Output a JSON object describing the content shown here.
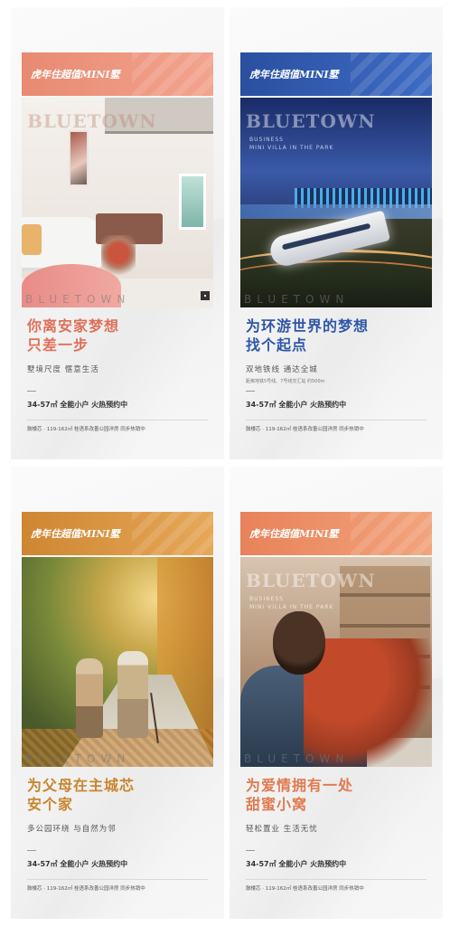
{
  "posters": [
    {
      "banner": "虎年住超值MINI墅",
      "banner_color": "#e8866e",
      "headline_lines": [
        "你离安家梦想",
        "只差一步"
      ],
      "headline_color": "#e0705a",
      "subline": "墅境尺度  惬意生活",
      "detail": "",
      "promo": "34-57㎡ 全能小户  火热预约中",
      "footer": "鼓楼芯 · 119-162㎡ 桂语系改善公园洋房  同步热销中",
      "watermark_big": "BLUETOWN",
      "watermark_bottom": "BLUETOWN"
    },
    {
      "banner": "虎年住超值MINI墅",
      "banner_color": "#2f56a8",
      "headline_lines": [
        "为环游世界的梦想",
        "找个起点"
      ],
      "headline_color": "#2f56a8",
      "subline": "双地铁线  通达全城",
      "detail": "距离地铁5号线、7号线交汇站 约500m",
      "promo": "34-57㎡ 全能小户  火热预约中",
      "footer": "鼓楼芯 · 119-162㎡ 桂语系改善公园洋房  同步热销中",
      "watermark_big": "BLUETOWN",
      "watermark_sub": [
        "BUSINESS",
        "MINI VILLA IN THE PARK"
      ],
      "watermark_bottom": "BLUETOWN"
    },
    {
      "banner": "虎年住超值MINI墅",
      "banner_color": "#d08a3a",
      "headline_lines": [
        "为父母在主城芯",
        "安个家"
      ],
      "headline_color": "#c9852e",
      "subline": "多公园环绕  与自然为邻",
      "detail": "",
      "promo": "34-57㎡ 全能小户  火热预约中",
      "footer": "鼓楼芯 · 119-162㎡ 桂语系改善公园洋房  同步热销中",
      "watermark_big": "",
      "watermark_bottom": "BLUETOWN"
    },
    {
      "banner": "虎年住超值MINI墅",
      "banner_color": "#e8855a",
      "headline_lines": [
        "为爱情拥有一处",
        "甜蜜小窝"
      ],
      "headline_color": "#e07a50",
      "subline": "轻松置业  生活无忧",
      "detail": "",
      "promo": "34-57㎡ 全能小户  火热预约中",
      "footer": "鼓楼芯 · 119-162㎡ 桂语系改善公园洋房  同步热销中",
      "watermark_big": "BLUETOWN",
      "watermark_sub": [
        "BUSINESS",
        "MINI VILLA IN THE PARK"
      ],
      "watermark_bottom": "BLUETOWN"
    }
  ]
}
